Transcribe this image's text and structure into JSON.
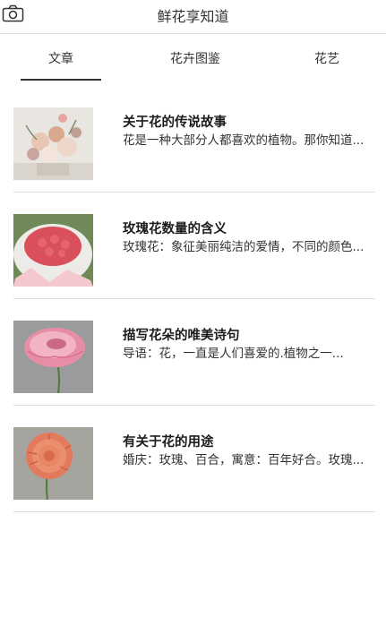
{
  "header": {
    "title": "鲜花享知道",
    "camera_icon": "camera-icon"
  },
  "tabs": [
    {
      "label": "文章",
      "active": true
    },
    {
      "label": "花卉图鉴",
      "active": false
    },
    {
      "label": "花艺",
      "active": false
    }
  ],
  "articles": [
    {
      "title": "关于花的传说故事",
      "desc": "花是一种大部分人都喜欢的植物。那你知道..."
    },
    {
      "title": "玫瑰花数量的含义",
      "desc": "玫瑰花：象征美丽纯洁的爱情，不同的颜色..."
    },
    {
      "title": "描写花朵的唯美诗句",
      "desc": "导语：花，一直是人们喜爱的.植物之一..."
    },
    {
      "title": "有关于花的用途",
      "desc": "婚庆：玫瑰、百合，寓意：百年好合。玫瑰..."
    }
  ],
  "colors": {
    "divider": "#dddddd",
    "tab_underline": "#333333",
    "text": "#222222"
  }
}
